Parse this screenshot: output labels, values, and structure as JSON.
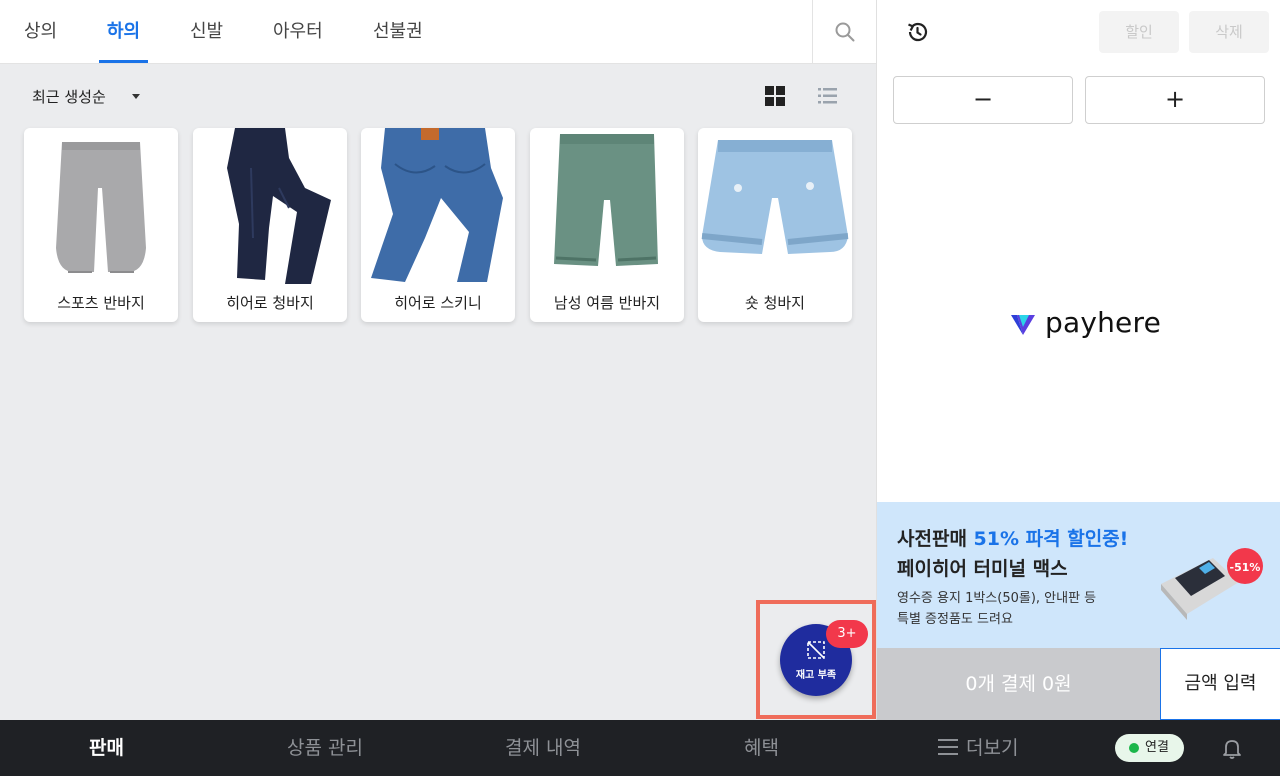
{
  "tabs": [
    {
      "label": "상의",
      "active": false
    },
    {
      "label": "하의",
      "active": true
    },
    {
      "label": "신발",
      "active": false
    },
    {
      "label": "아우터",
      "active": false
    },
    {
      "label": "선불권",
      "active": false
    }
  ],
  "toolbar": {
    "sort_label": "최근 생성순",
    "view_mode": "grid"
  },
  "products": [
    {
      "name": "스포츠 반바지",
      "icon": "gray-shorts-image"
    },
    {
      "name": "히어로 청바지",
      "icon": "dark-jeans-image"
    },
    {
      "name": "히어로 스키니",
      "icon": "blue-jeans-image"
    },
    {
      "name": "남성 여름 반바지",
      "icon": "green-shorts-image"
    },
    {
      "name": "숏 청바지",
      "icon": "denim-shorts-image"
    }
  ],
  "stock_alert": {
    "label": "재고 부족",
    "badge": "3+"
  },
  "right_panel": {
    "discount_label": "할인",
    "delete_label": "삭제",
    "minus_label": "−",
    "plus_label": "+",
    "logo_text": "payhere",
    "promo": {
      "prefix": "사전판매 ",
      "highlight": "51% 파격 할인중!",
      "line2": "페이히어 터미널 맥스",
      "line3": "영수증 용지 1박스(50롤), 안내판 등",
      "line4": "특별 증정품도 드려요",
      "sticker": "-51%"
    },
    "pay_summary": "0개 결제  0원",
    "amount_label": "금액 입력"
  },
  "bottom_nav": {
    "items": [
      {
        "label": "판매",
        "active": true
      },
      {
        "label": "상품 관리",
        "active": false
      },
      {
        "label": "결제 내역",
        "active": false
      },
      {
        "label": "혜택",
        "active": false
      },
      {
        "label": "더보기",
        "active": false
      }
    ],
    "connection": "연결"
  },
  "colors": {
    "accent": "#1a73e8",
    "fab": "#1f2c9e",
    "badge": "#f2384b",
    "nav_bg": "#1f2125",
    "promo_bg": "#cfe6fb"
  }
}
